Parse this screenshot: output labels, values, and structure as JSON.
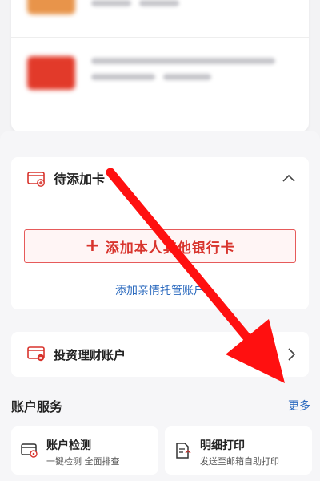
{
  "pending_cards": {
    "title": "待添加卡",
    "add_bank_button": "添加本人其他银行卡",
    "add_bank_plus": "+",
    "trust_link": "添加亲情托管账户"
  },
  "invest": {
    "label": "投资理财账户"
  },
  "services": {
    "title": "账户服务",
    "more": "更多",
    "items": [
      {
        "name": "账户检测",
        "desc": "一键检测 全面排查"
      },
      {
        "name": "明细打印",
        "desc": "发送至邮箱自助打印"
      }
    ]
  },
  "colors": {
    "accent_red": "#d8342d",
    "link_blue": "#2d6bbf",
    "annotation_arrow": "#ff1010"
  },
  "icons": {
    "pending": "card-add-icon",
    "invest": "card-lock-icon",
    "collapse": "chevron-up-icon",
    "enter": "chevron-right-icon",
    "check": "card-check-icon",
    "print": "document-print-icon"
  }
}
